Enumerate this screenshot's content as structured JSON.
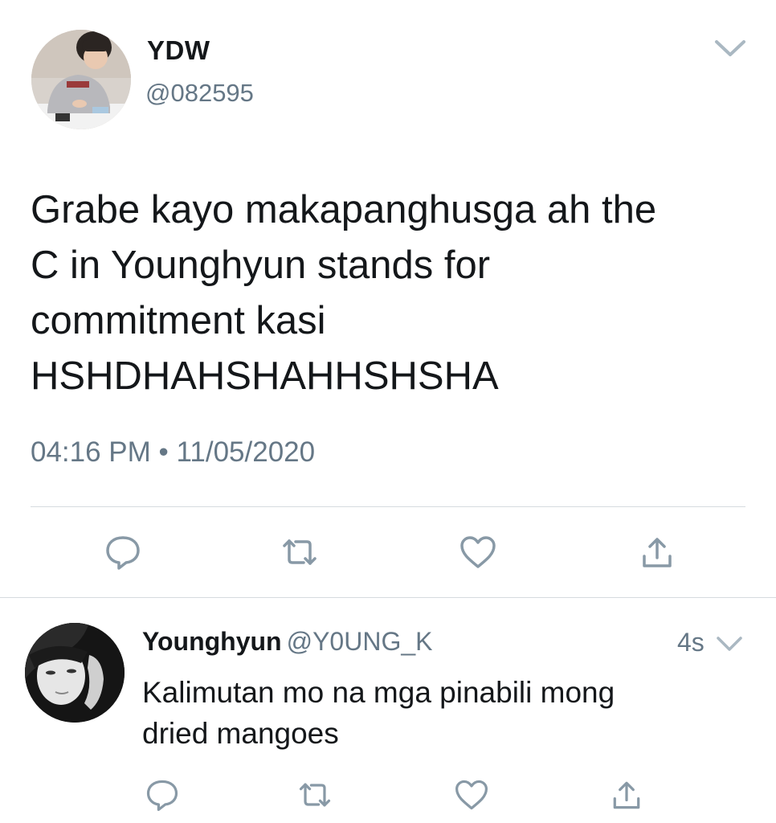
{
  "main_tweet": {
    "display_name": "YDW",
    "handle": "@082595",
    "text_lines": [
      "Grabe kayo makapanghusga ah the",
      "C in Younghyun stands for",
      "commitment kasi",
      "HSHDHAHSHAHHSHSHA"
    ],
    "timestamp": "04:16 PM • 11/05/2020",
    "actions": [
      "reply-icon",
      "retweet-icon",
      "like-icon",
      "share-icon"
    ]
  },
  "reply": {
    "display_name": "Younghyun",
    "handle": "@Y0UNG_K",
    "time": "4s",
    "text_lines": [
      "Kalimutan mo na mga pinabili mong",
      "dried mangoes"
    ],
    "actions": [
      "reply-icon",
      "retweet-icon",
      "like-icon",
      "share-icon"
    ]
  },
  "colors": {
    "text": "#14171a",
    "secondary": "#657786",
    "icon": "#8899a6",
    "divider": "#d6dbdf"
  }
}
